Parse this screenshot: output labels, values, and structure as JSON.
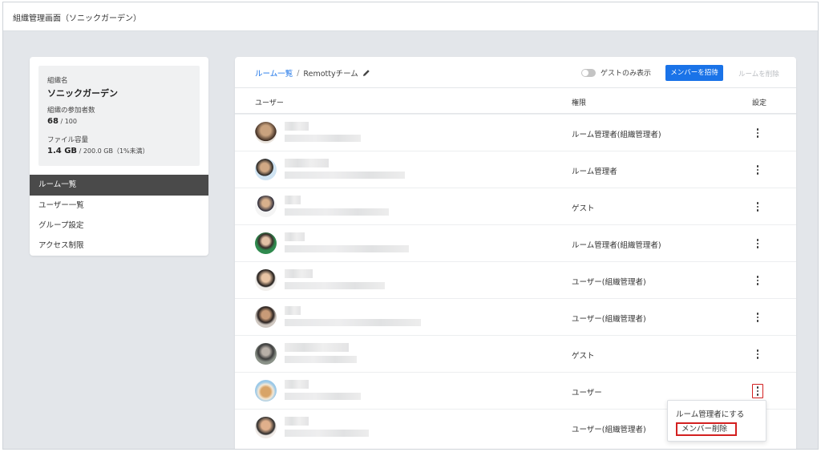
{
  "window": {
    "title": "組織管理画面（ソニックガーデン）"
  },
  "org": {
    "name_label": "組織名",
    "name": "ソニックガーデン",
    "members_label": "組織の参加者数",
    "members_count": "68",
    "members_total": " / 100",
    "storage_label": "ファイル容量",
    "storage_used": "1.4 GB",
    "storage_total": " / 200.0 GB（1%未満）"
  },
  "sidebar": {
    "items": [
      {
        "label": "ルーム一覧",
        "active": true
      },
      {
        "label": "ユーザー一覧"
      },
      {
        "label": "グループ設定"
      },
      {
        "label": "アクセス制限"
      }
    ]
  },
  "main": {
    "breadcrumb_link": "ルーム一覧",
    "breadcrumb_sep": "/",
    "breadcrumb_current": "Remottyチーム",
    "guest_only_label": "ゲストのみ表示",
    "guest_only_on": false,
    "invite_label": "メンバーを招待",
    "delete_room_label": "ルームを削除",
    "columns": {
      "user": "ユーザー",
      "role": "権限",
      "settings": "設定"
    },
    "rows": [
      {
        "role": "ルーム管理者(組織管理者)"
      },
      {
        "role": "ルーム管理者"
      },
      {
        "role": "ゲスト"
      },
      {
        "role": "ルーム管理者(組織管理者)"
      },
      {
        "role": "ユーザー(組織管理者)"
      },
      {
        "role": "ユーザー(組織管理者)"
      },
      {
        "role": "ゲスト"
      },
      {
        "role": "ユーザー"
      },
      {
        "role": "ユーザー(組織管理者)"
      }
    ]
  },
  "context_menu": {
    "make_admin": "ルーム管理者にする",
    "remove_member": "メンバー削除"
  },
  "colors": {
    "accent": "#1a73e8",
    "highlight": "#d32020",
    "sidebar_active": "#4a4a4a"
  }
}
